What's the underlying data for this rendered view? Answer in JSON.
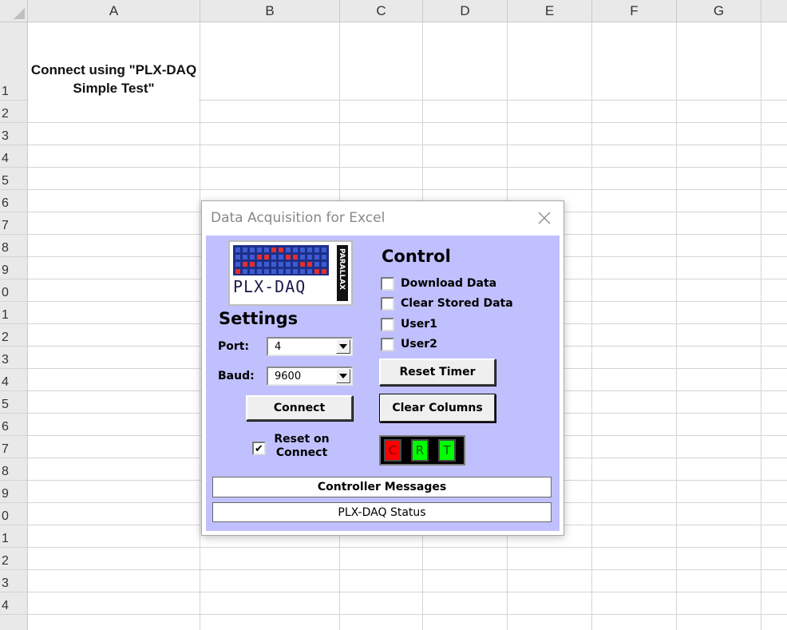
{
  "sheet": {
    "columns": [
      "A",
      "B",
      "C",
      "D",
      "E",
      "F",
      "G"
    ],
    "rows": [
      "1",
      "2",
      "3",
      "4",
      "5",
      "6",
      "7",
      "8",
      "9",
      "0",
      "1",
      "2",
      "3",
      "4",
      "5",
      "6",
      "7",
      "8",
      "9",
      "0",
      "1",
      "2",
      "3",
      "4"
    ],
    "a1_text": "Connect using \"PLX-DAQ Simple Test\""
  },
  "dialog": {
    "title": "Data Acquisition for Excel",
    "logo": {
      "text": "PLX-DAQ",
      "side_text": "PARALLAX"
    },
    "settings": {
      "heading": "Settings",
      "port_label": "Port:",
      "port_value": "4",
      "baud_label": "Baud:",
      "baud_value": "9600",
      "connect_label": "Connect",
      "reset_on_connect_label": "Reset on Connect",
      "reset_on_connect_checked": true
    },
    "control": {
      "heading": "Control",
      "checkboxes": [
        {
          "label": "Download Data",
          "checked": false
        },
        {
          "label": "Clear Stored Data",
          "checked": false
        },
        {
          "label": "User1",
          "checked": false
        },
        {
          "label": "User2",
          "checked": false
        }
      ],
      "reset_timer_label": "Reset Timer",
      "clear_columns_label": "Clear Columns"
    },
    "indicators": [
      {
        "label": "C",
        "color": "#ff0000"
      },
      {
        "label": "R",
        "color": "#00ff00"
      },
      {
        "label": "T",
        "color": "#00ff00"
      }
    ],
    "controller_messages": "Controller Messages",
    "status": "PLX-DAQ Status"
  },
  "colors": {
    "dialog_background": "#c0c0ff",
    "header_gray": "#e9e9e9"
  }
}
